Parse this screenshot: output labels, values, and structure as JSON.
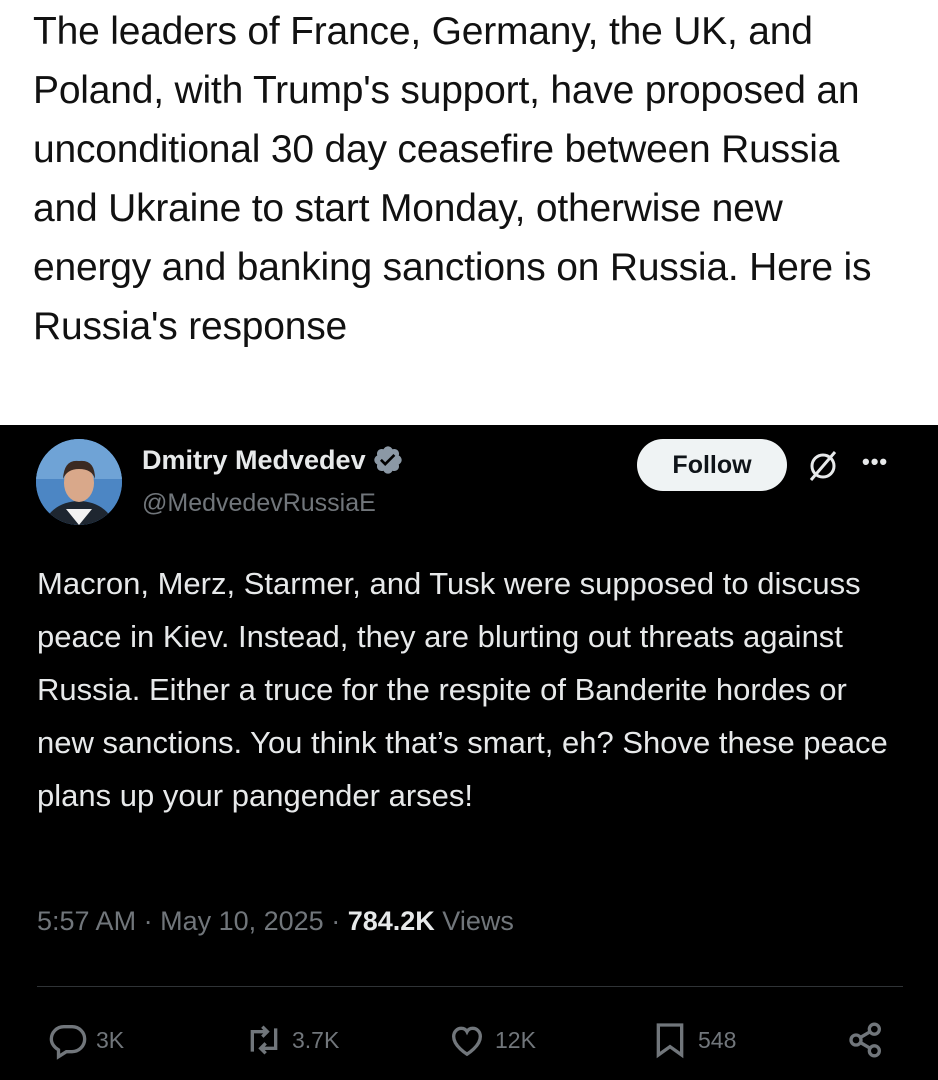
{
  "caption": {
    "text": "The leaders of France, Germany, the UK, and Poland, with Trump's support, have proposed an unconditional 30 day ceasefire between Russia and Ukraine to start Monday, otherwise new energy and banking sanctions on Russia. Here is Russia's response"
  },
  "tweet": {
    "author_name": "Dmitry Medvedev",
    "handle": "@MedvedevRussiaE",
    "follow_label": "Follow",
    "body": "Macron, Merz, Starmer, and Tusk were supposed to discuss peace in Kiev. Instead, they are blurting out threats against Russia. Either a truce for the respite of Banderite hordes or new sanctions. You think that’s smart, eh? Shove these peace plans up your pangender arses!",
    "time": "5:57 AM",
    "date": "May 10, 2025",
    "views_count": "784.2K",
    "views_label": "Views",
    "actions": {
      "replies": "3K",
      "reposts": "3.7K",
      "likes": "12K",
      "bookmarks": "548"
    }
  },
  "colors": {
    "accent_verified": "#1d9bf0",
    "muted_text": "#71767b",
    "tweet_bg": "#000000"
  },
  "icons": [
    "verified-badge-icon",
    "grok-icon",
    "more-icon",
    "reply-icon",
    "repost-icon",
    "like-icon",
    "bookmark-icon",
    "share-icon"
  ]
}
